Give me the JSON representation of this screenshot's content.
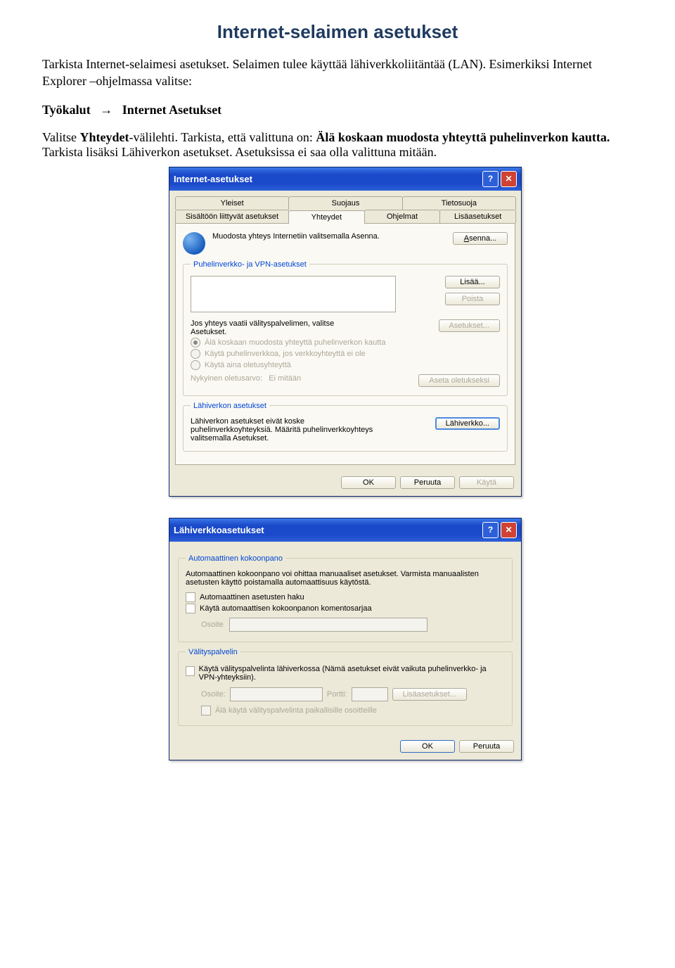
{
  "doc": {
    "heading": "Internet-selaimen asetukset",
    "para1_a": "Tarkista Internet-selaimesi asetukset. Selaimen tulee käyttää lähiverkkoliitäntää (LAN). Esimerkiksi Internet Explorer –ohjelmassa valitse:",
    "para2_bold1": "Työkalut",
    "para2_arrow": "→",
    "para2_bold2": "Internet Asetukset",
    "para3_a": "Valitse ",
    "para3_bold1": "Yhteydet",
    "para3_b": "-välilehti. Tarkista, että valittuna on: ",
    "para3_bold2": "Älä koskaan muodosta yhteyttä puhelinverkon kautta.",
    "para3_c": " Tarkista lisäksi Lähiverkon asetukset. Asetuksissa ei saa olla valittuna mitään."
  },
  "dlg1": {
    "title": "Internet-asetukset",
    "tabs_r1": [
      "Yleiset",
      "Suojaus",
      "Tietosuoja"
    ],
    "tabs_r2": [
      "Sisältöön liittyvät asetukset",
      "Yhteydet",
      "Ohjelmat",
      "Lisäasetukset"
    ],
    "row1_text": "Muodosta yhteys Internetiin valitsemalla Asenna.",
    "btn_asenna": "Asenna...",
    "fs1_legend": "Puhelinverkko- ja VPN-asetukset",
    "btn_lisaa": "Lisää...",
    "btn_poista": "Poista",
    "fs1_text": "Jos yhteys vaatii välityspalvelimen, valitse Asetukset.",
    "btn_asetukset": "Asetukset...",
    "radio1": "Älä koskaan muodosta yhteyttä puhelinverkon kautta",
    "radio2": "Käytä puhelinverkkoa, jos verkkoyhteyttä ei ole",
    "radio3": "Käytä aina oletusyhteyttä",
    "nyk_label": "Nykyinen oletusarvo:",
    "nyk_value": "Ei mitään",
    "btn_aseta": "Aseta oletukseksi",
    "fs2_legend": "Lähiverkon asetukset",
    "fs2_text": "Lähiverkon asetukset eivät koske puhelinverkkoyhteyksiä. Määritä puhelinverkkoyhteys valitsemalla Asetukset.",
    "btn_lahi": "Lähiverkko...",
    "btn_ok": "OK",
    "btn_peruuta": "Peruuta",
    "btn_kayta": "Käytä"
  },
  "dlg2": {
    "title": "Lähiverkkoasetukset",
    "fs1_legend": "Automaattinen kokoonpano",
    "fs1_text": "Automaattinen kokoonpano voi ohittaa manuaaliset asetukset. Varmista manuaalisten asetusten käyttö poistamalla automaattisuus käytöstä.",
    "cb1": "Automaattinen asetusten haku",
    "cb2": "Käytä automaattisen kokoonpanon komentosarjaa",
    "osoite_label": "Osoite",
    "fs2_legend": "Välityspalvelin",
    "cb3": "Käytä välityspalvelinta lähiverkossa (Nämä asetukset eivät vaikuta puhelinverkko- ja VPN-yhteyksiin).",
    "osoite2": "Osoite:",
    "portti": "Portti:",
    "btn_lisaas": "Lisäasetukset...",
    "cb4": "Älä käytä välityspalvelinta paikallisille osoitteille",
    "btn_ok": "OK",
    "btn_peruuta": "Peruuta"
  }
}
